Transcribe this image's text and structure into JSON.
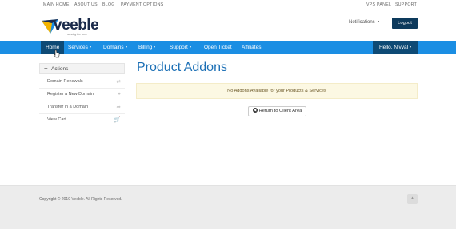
{
  "topbar": {
    "left_links": [
      "MAIN HOME",
      "ABOUT US",
      "BLOG",
      "PAYMENT OPTIONS"
    ],
    "right_links": [
      "VPS PANEL",
      "SUPPORT"
    ]
  },
  "brand": {
    "name": "veeble",
    "tagline": "serving the web",
    "logo_color": "#1a2a4a",
    "accent_yellow": "#f4b400",
    "accent_blue": "#1b8ee3"
  },
  "header": {
    "notifications_label": "Notifications",
    "logout_label": "Logout"
  },
  "nav": {
    "items": [
      "Home",
      "Services",
      "Domains",
      "Billing",
      "Support",
      "Open Ticket",
      "Affiliates"
    ],
    "active": "Home",
    "user_menu_label": "Hello, Nivyal",
    "bg_color": "#1b8ee3",
    "active_color": "#0e4a75"
  },
  "sidebar": {
    "heading": "Actions",
    "items": [
      {
        "label": "Domain Renewals",
        "icon": "refresh-icon"
      },
      {
        "label": "Register a New Domain",
        "icon": "globe-icon"
      },
      {
        "label": "Transfer in a Domain",
        "icon": "share-icon"
      },
      {
        "label": "View Cart",
        "icon": "cart-icon"
      }
    ]
  },
  "main": {
    "title": "Product Addons",
    "alert_text": "No Addons Available for your Products & Services",
    "return_button_label": "Return to Client Area"
  },
  "footer": {
    "copyright": "Copyright © 2019 Veeble. All Rights Reserved."
  }
}
